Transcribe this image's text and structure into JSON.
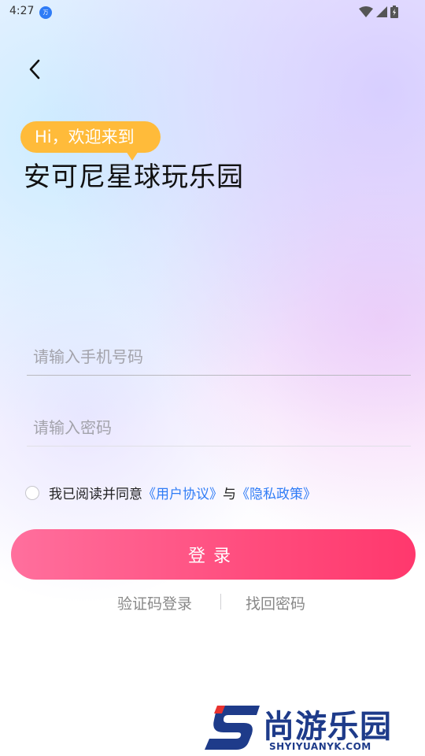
{
  "status_bar": {
    "time": "4:27",
    "app_icon_text": "万"
  },
  "header": {
    "greeting": "Hi，欢迎来到",
    "title": "安可尼星球玩乐园"
  },
  "form": {
    "phone_placeholder": "请输入手机号码",
    "password_placeholder": "请输入密码"
  },
  "agreement": {
    "prefix": "我已阅读并同意",
    "user_agreement": "《用户协议》",
    "joiner": "与",
    "privacy_policy": "《隐私政策》"
  },
  "login_button": "登录",
  "alt_links": {
    "sms_login": "验证码登录",
    "forgot_password": "找回密码"
  },
  "watermark": {
    "text": "尚游乐园",
    "url": "SHYIYUANYK.COM"
  },
  "colors": {
    "accent_pink": "#ff4c7d",
    "link_blue": "#2f7cf6",
    "bubble_orange": "#ffbb3a"
  }
}
